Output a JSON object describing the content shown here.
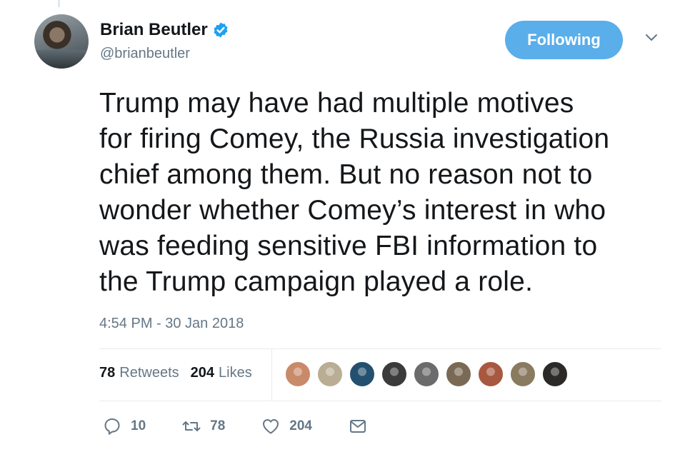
{
  "user": {
    "display_name": "Brian Beutler",
    "handle": "@brianbeutler",
    "verified_icon": "verified-badge-icon"
  },
  "follow_button": {
    "label": "Following"
  },
  "tweet": {
    "lines": [
      "Trump may have had multiple motives",
      "for firing Comey, the Russia investigation",
      "chief among them. But no reason not to",
      "wonder whether Comey’s interest in who",
      "was feeding sensitive FBI information to",
      "the Trump campaign played a role."
    ],
    "timestamp": "4:54 PM - 30 Jan 2018"
  },
  "stats": {
    "retweets_count": "78",
    "retweets_label": "Retweets",
    "likes_count": "204",
    "likes_label": "Likes"
  },
  "likers": [
    {
      "color": "#c98a6a"
    },
    {
      "color": "#b9ad93"
    },
    {
      "color": "#23506e"
    },
    {
      "color": "#3b3b3b"
    },
    {
      "color": "#6b6b6b"
    },
    {
      "color": "#7a6a55"
    },
    {
      "color": "#a8583f"
    },
    {
      "color": "#8a7a60"
    },
    {
      "color": "#2c2a28"
    }
  ],
  "actions": {
    "reply_count": "10",
    "retweet_count": "78",
    "like_count": "204"
  },
  "colors": {
    "accent": "#1da1f2",
    "follow_bg": "#5aaeea",
    "muted": "#657786",
    "text": "#14171a"
  }
}
